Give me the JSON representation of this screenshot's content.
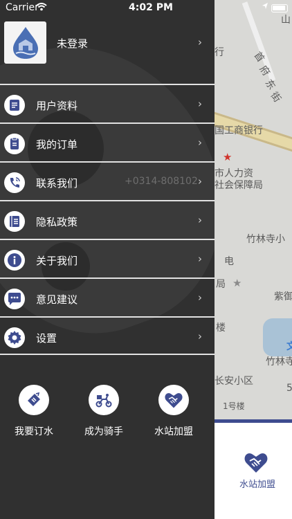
{
  "status_bar": {
    "carrier": "Carrier",
    "time": "4:02 PM"
  },
  "drawer": {
    "profile": {
      "login_text": "未登录"
    },
    "menu": [
      {
        "label": "用户资料",
        "icon": "user-profile-icon"
      },
      {
        "label": "我的订单",
        "icon": "order-icon"
      },
      {
        "label": "联系我们",
        "icon": "phone-icon",
        "extra": "+0314-808102"
      },
      {
        "label": "隐私政策",
        "icon": "privacy-icon"
      },
      {
        "label": "关于我们",
        "icon": "info-icon"
      },
      {
        "label": "意见建议",
        "icon": "feedback-icon"
      },
      {
        "label": "设置",
        "icon": "gear-icon"
      }
    ],
    "quick_actions": [
      {
        "label": "我要订水",
        "icon": "order-water-icon"
      },
      {
        "label": "成为骑手",
        "icon": "rider-icon"
      },
      {
        "label": "水站加盟",
        "icon": "handshake-icon"
      }
    ]
  },
  "map": {
    "labels": [
      "行",
      "首",
      "府",
      "东",
      "街",
      "国工商银行",
      "市人力资",
      "社会保障局",
      "竹林寺小",
      "电",
      "局",
      "紫御",
      "楼",
      "竹林寺",
      "长安小区",
      "1号楼",
      "5",
      "文",
      "山"
    ],
    "bottom_tab": {
      "label": "水站加盟"
    }
  },
  "colors": {
    "accent": "#3e4c8f",
    "drawer_bg": "#303030"
  }
}
